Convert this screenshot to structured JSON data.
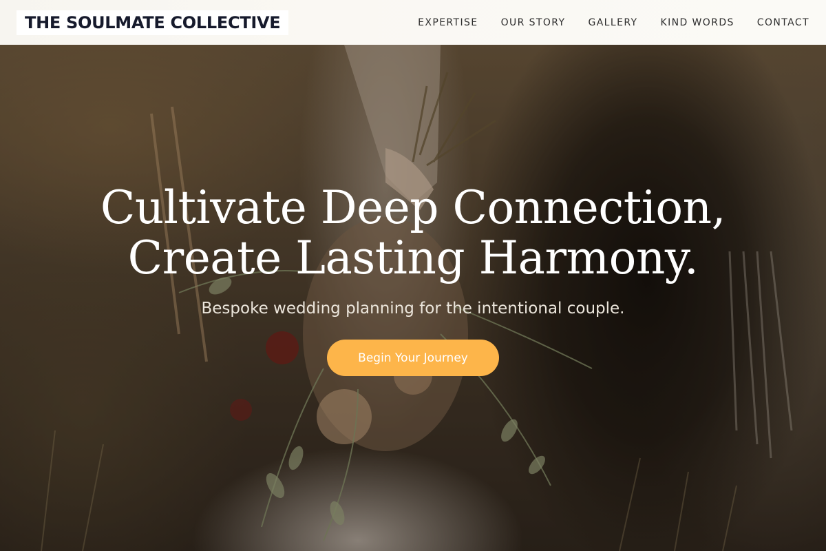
{
  "brand": {
    "name": "THE SOULMATE COLLECTIVE"
  },
  "nav": {
    "items": [
      {
        "label": "EXPERTISE"
      },
      {
        "label": "OUR STORY"
      },
      {
        "label": "GALLERY"
      },
      {
        "label": "KIND WORDS"
      },
      {
        "label": "CONTACT"
      }
    ]
  },
  "hero": {
    "headline_line1": "Cultivate Deep Connection,",
    "headline_line2": "Create Lasting Harmony.",
    "subheadline": "Bespoke wedding planning for the intentional couple.",
    "cta_label": "Begin Your Journey",
    "image_description_icon": "wedding-bouquet-photo"
  },
  "colors": {
    "accent": "#fdb54a",
    "brand_text": "#161a2c",
    "header_bg": "#f9f7f2"
  }
}
